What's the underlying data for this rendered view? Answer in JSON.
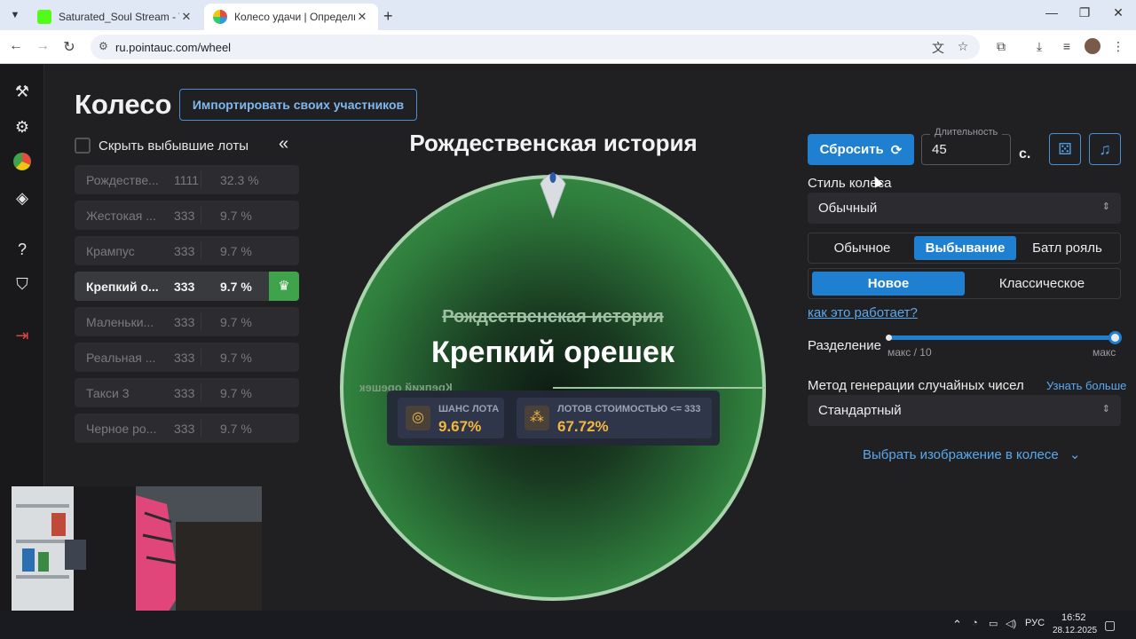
{
  "browser": {
    "tabs": [
      {
        "title": "Saturated_Soul Stream - Watch",
        "active": false
      },
      {
        "title": "Колесо удачи | Определите по",
        "active": true
      }
    ],
    "url": "ru.pointauc.com/wheel"
  },
  "page": {
    "title": "Колесо",
    "import_button": "Импортировать своих участников",
    "hide_eliminated": "Скрыть выбывшие лоты"
  },
  "lots": [
    {
      "name": "Рождестве...",
      "amount": "1111",
      "percent": "32.3 %",
      "state": "eliminated"
    },
    {
      "name": "Жестокая ...",
      "amount": "333",
      "percent": "9.7 %",
      "state": "eliminated"
    },
    {
      "name": "Крампус",
      "amount": "333",
      "percent": "9.7 %",
      "state": "eliminated"
    },
    {
      "name": "Крепкий о...",
      "amount": "333",
      "percent": "9.7 %",
      "state": "active"
    },
    {
      "name": "Маленьки...",
      "amount": "333",
      "percent": "9.7 %",
      "state": "eliminated"
    },
    {
      "name": "Реальная ...",
      "amount": "333",
      "percent": "9.7 %",
      "state": "eliminated"
    },
    {
      "name": "Такси 3",
      "amount": "333",
      "percent": "9.7 %",
      "state": "eliminated"
    },
    {
      "name": "Черное ро...",
      "amount": "333",
      "percent": "9.7 %",
      "state": "eliminated"
    }
  ],
  "wheel": {
    "title": "Рождественская история",
    "previous": "Рождественская история",
    "winner": "Крепкий орешек",
    "mirror_label": "Крепкий орешек",
    "stats": {
      "chance_label": "ШАНС ЛОТА",
      "chance_value": "9.67%",
      "cost_label": "ЛОТОВ СТОИМОСТЬЮ <= 333",
      "cost_value": "67.72%"
    }
  },
  "controls": {
    "reset": "Сбросить",
    "duration_label": "Длительность",
    "duration_value": "45",
    "duration_unit": "с.",
    "wheel_style_label": "Стиль колеса",
    "wheel_style_value": "Обычный",
    "modes": [
      "Обычное",
      "Выбывание",
      "Батл рояль"
    ],
    "active_mode": "Выбывание",
    "variants": [
      "Новое",
      "Классическое"
    ],
    "active_variant": "Новое",
    "how_it_works": "как это работает?",
    "split_label": "Разделение",
    "split_min": "макс / 10",
    "split_max": "макс",
    "split_level": 1.0,
    "rng_label": "Метод генерации случайных чисел",
    "learn_more": "Узнать больше",
    "rng_value": "Стандартный",
    "choose_image": "Выбрать изображение в колесе"
  },
  "taskbar": {
    "lang": "РУС",
    "time": "16:52",
    "date": "28.12.2025"
  },
  "colors": {
    "accent": "#1f7fd0",
    "wheel_green": "#43a352",
    "winner_badge": "#3ea34a",
    "stat_value": "#f4b73d"
  }
}
